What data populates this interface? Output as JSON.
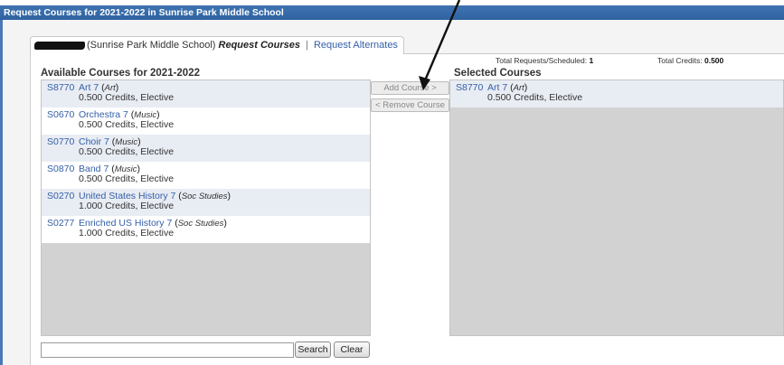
{
  "window": {
    "title": "Request Courses for 2021-2022 in Sunrise Park Middle School"
  },
  "tab": {
    "school": "(Sunrise Park Middle School)",
    "current": "Request Courses",
    "separator": "|",
    "alternates": "Request Alternates"
  },
  "totals": {
    "requests_label": "Total Requests/Scheduled:",
    "requests_value": "1",
    "credits_label": "Total Credits:",
    "credits_value": "0.500"
  },
  "available": {
    "heading": "Available Courses for 2021-2022",
    "courses": [
      {
        "code": "S8770",
        "name": "Art 7",
        "subject": "Art",
        "details": "0.500 Credits,  Elective"
      },
      {
        "code": "S0670",
        "name": "Orchestra 7",
        "subject": "Music",
        "details": "0.500 Credits,  Elective"
      },
      {
        "code": "S0770",
        "name": "Choir 7",
        "subject": "Music",
        "details": "0.500 Credits,  Elective"
      },
      {
        "code": "S0870",
        "name": "Band 7",
        "subject": "Music",
        "details": "0.500 Credits,  Elective"
      },
      {
        "code": "S0270",
        "name": "United States History 7",
        "subject": "Soc Studies",
        "details": "1.000 Credits,  Elective"
      },
      {
        "code": "S0277",
        "name": "Enriched US History 7",
        "subject": "Soc Studies",
        "details": "1.000 Credits,  Elective"
      }
    ]
  },
  "actions": {
    "add": "Add Course >",
    "remove": "< Remove Course"
  },
  "selected": {
    "heading": "Selected Courses",
    "courses": [
      {
        "code": "S8770",
        "name": "Art 7",
        "subject": "Art",
        "details": "0.500 Credits,  Elective"
      }
    ]
  },
  "search": {
    "value": "",
    "search_label": "Search",
    "clear_label": "Clear"
  },
  "colors": {
    "title_bar": "#3168a6",
    "link": "#3560a8",
    "row_alt": "#e8ecf3",
    "list_bg": "#d2d2d2"
  },
  "icons": {
    "redaction": "black-marker-redaction",
    "annotation": "pointer-arrow"
  }
}
